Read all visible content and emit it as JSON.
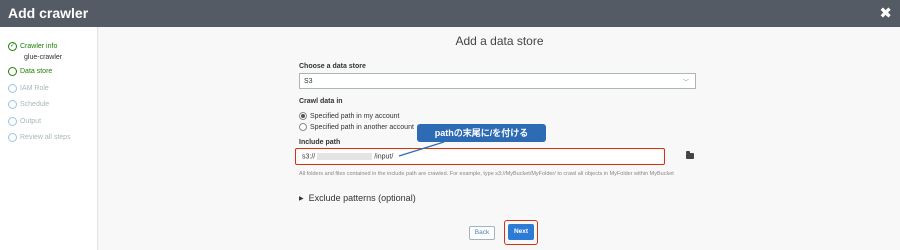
{
  "window": {
    "title": "Add crawler",
    "close_glyph": "✖"
  },
  "sidebar": {
    "steps": [
      {
        "label": "Crawler info",
        "state": "done",
        "sub": "glue-crawler"
      },
      {
        "label": "Data store",
        "state": "active"
      },
      {
        "label": "IAM Role",
        "state": "disabled"
      },
      {
        "label": "Schedule",
        "state": "disabled"
      },
      {
        "label": "Output",
        "state": "disabled"
      },
      {
        "label": "Review all steps",
        "state": "disabled"
      }
    ]
  },
  "main": {
    "title": "Add a data store",
    "choose_label": "Choose a data store",
    "data_store_value": "S3",
    "crawl_label": "Crawl data in",
    "radio_options": [
      {
        "label": "Specified path in my account",
        "selected": true
      },
      {
        "label": "Specified path in another account",
        "selected": false
      }
    ],
    "include_label": "Include path",
    "include_prefix": "s3://",
    "include_suffix": "/input/",
    "help_text": "All folders and files contained in the include path are crawled. For example, type s3://MyBucket/MyFolder/ to crawl all objects in MyFolder within MyBucket",
    "exclude_label": "Exclude patterns (optional)",
    "callout_text": "pathの末尾に/を付ける",
    "back_label": "Back",
    "next_label": "Next"
  },
  "colors": {
    "titlebar": "#545b64",
    "success": "#1d8102",
    "highlight": "#d13212",
    "primary": "#2e7bd6",
    "callout": "#2d6cb5"
  }
}
